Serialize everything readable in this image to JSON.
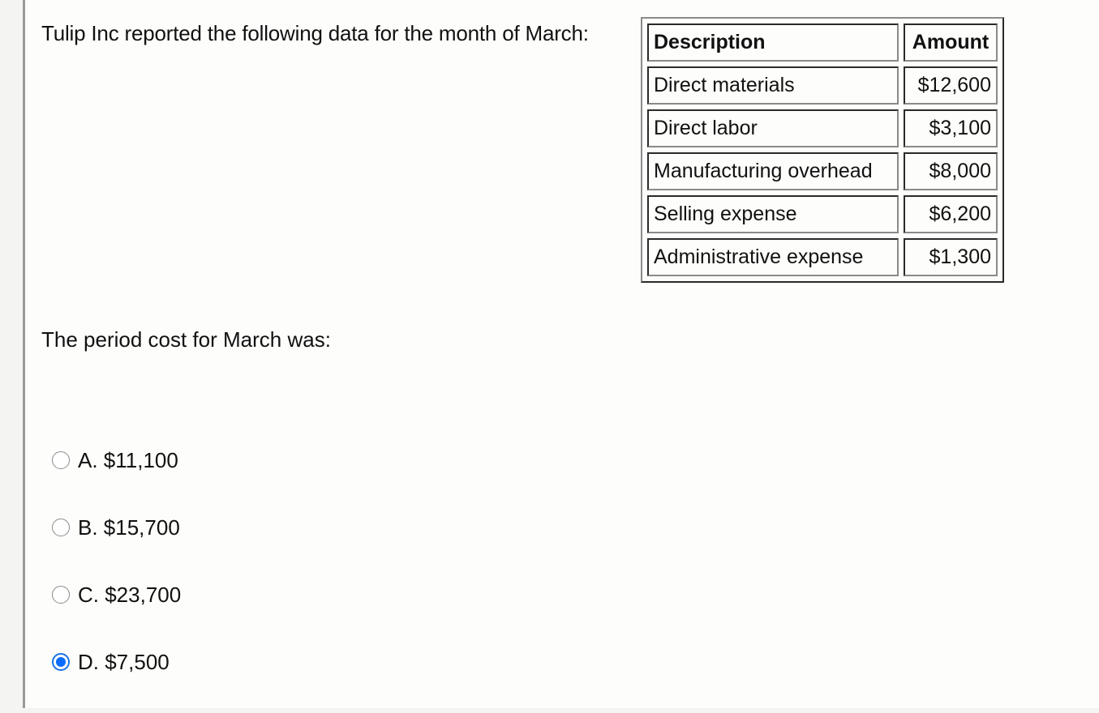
{
  "question": {
    "intro": "Tulip Inc reported the following data for the month of March:",
    "prompt": "The period cost for March was:"
  },
  "table": {
    "headers": [
      "Description",
      "Amount"
    ],
    "rows": [
      {
        "description": "Direct materials",
        "amount": "$12,600"
      },
      {
        "description": "Direct labor",
        "amount": "$3,100"
      },
      {
        "description": "Manufacturing overhead",
        "amount": "$8,000"
      },
      {
        "description": "Selling expense",
        "amount": "$6,200"
      },
      {
        "description": "Administrative expense",
        "amount": "$1,300"
      }
    ]
  },
  "options": [
    {
      "label": "A. $11,100",
      "selected": false
    },
    {
      "label": "B. $15,700",
      "selected": false
    },
    {
      "label": "C. $23,700",
      "selected": false
    },
    {
      "label": "D. $7,500",
      "selected": true
    }
  ],
  "colors": {
    "selected_radio": "#0a6cff"
  }
}
